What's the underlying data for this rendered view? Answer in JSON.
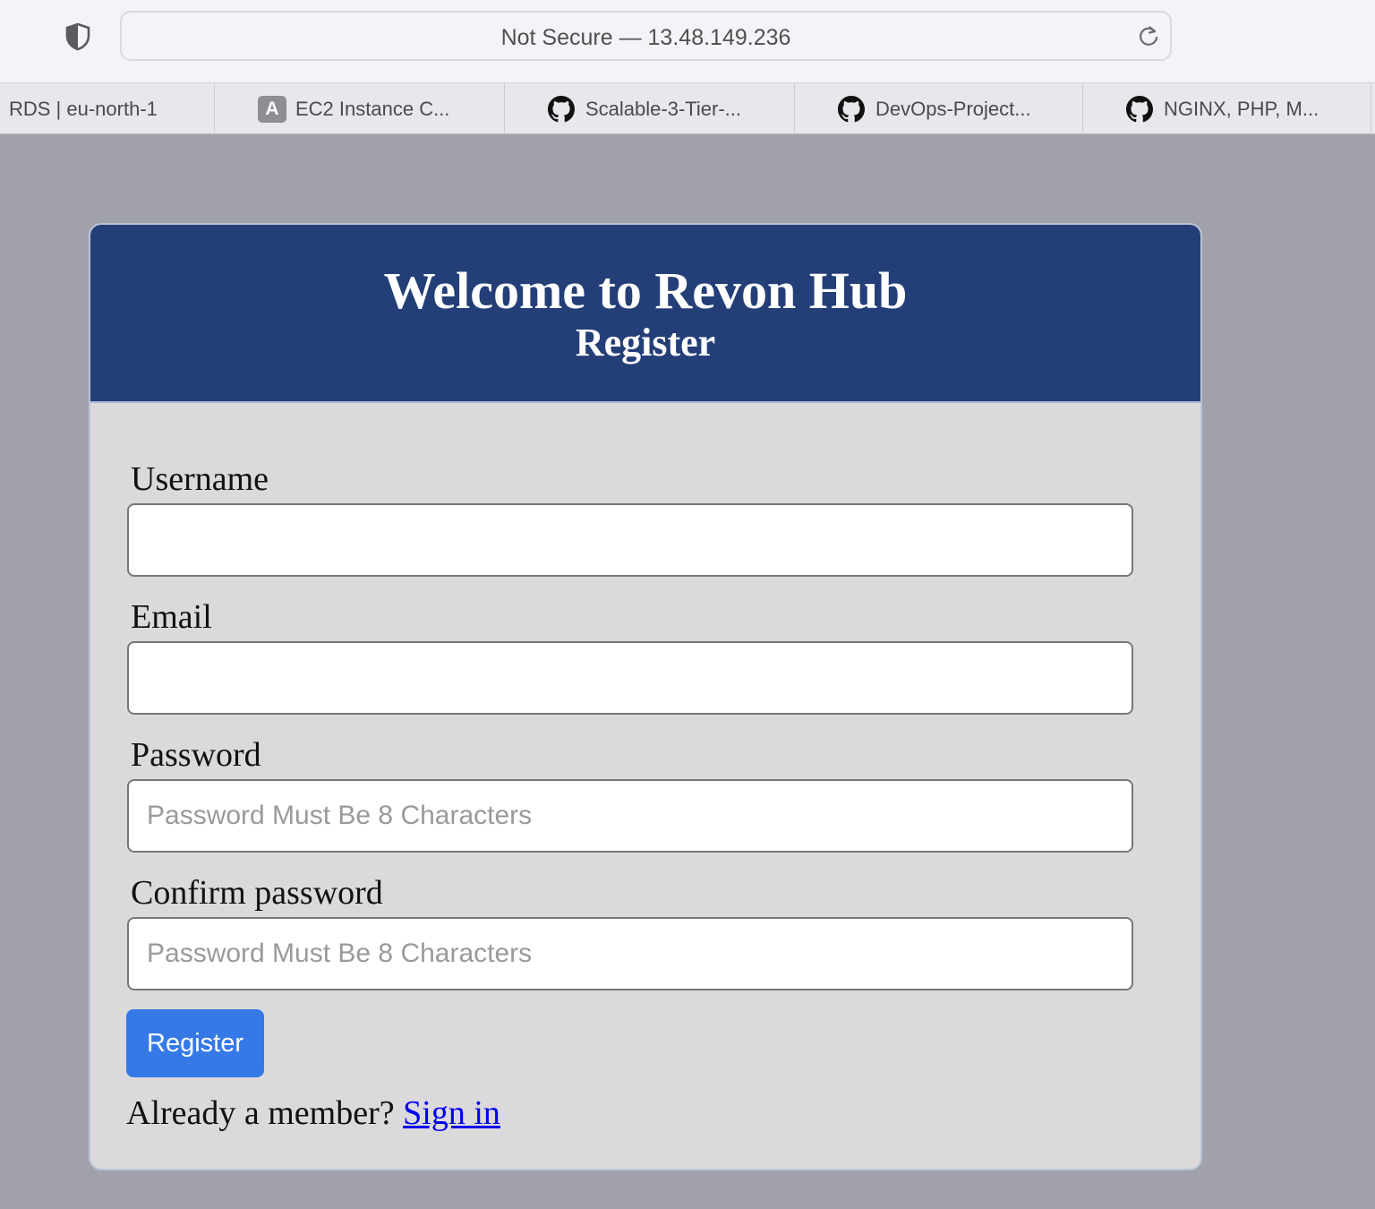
{
  "browser": {
    "url_text": "Not Secure — 13.48.149.236",
    "tabs": [
      {
        "label": "RDS | eu-north-1",
        "icon": "none"
      },
      {
        "label": "EC2 Instance C...",
        "icon": "a-badge-icon",
        "badge": "A"
      },
      {
        "label": "Scalable-3-Tier-...",
        "icon": "github-icon"
      },
      {
        "label": "DevOps-Project...",
        "icon": "github-icon"
      },
      {
        "label": "NGINX, PHP, M...",
        "icon": "github-icon"
      }
    ]
  },
  "form": {
    "title": "Welcome to Revon Hub",
    "subtitle": "Register",
    "username_label": "Username",
    "username_value": "",
    "email_label": "Email",
    "email_value": "",
    "password_label": "Password",
    "password_placeholder": "Password Must Be 8 Characters",
    "confirm_label": "Confirm password",
    "confirm_placeholder": "Password Must Be 8 Characters",
    "submit_label": "Register",
    "member_text": "Already a member?",
    "signin_label": "Sign in"
  },
  "colors": {
    "header_bg": "#243f77",
    "button_bg": "#3579e6",
    "page_bg": "#a0a1ab",
    "card_bg": "#dbd9db"
  }
}
